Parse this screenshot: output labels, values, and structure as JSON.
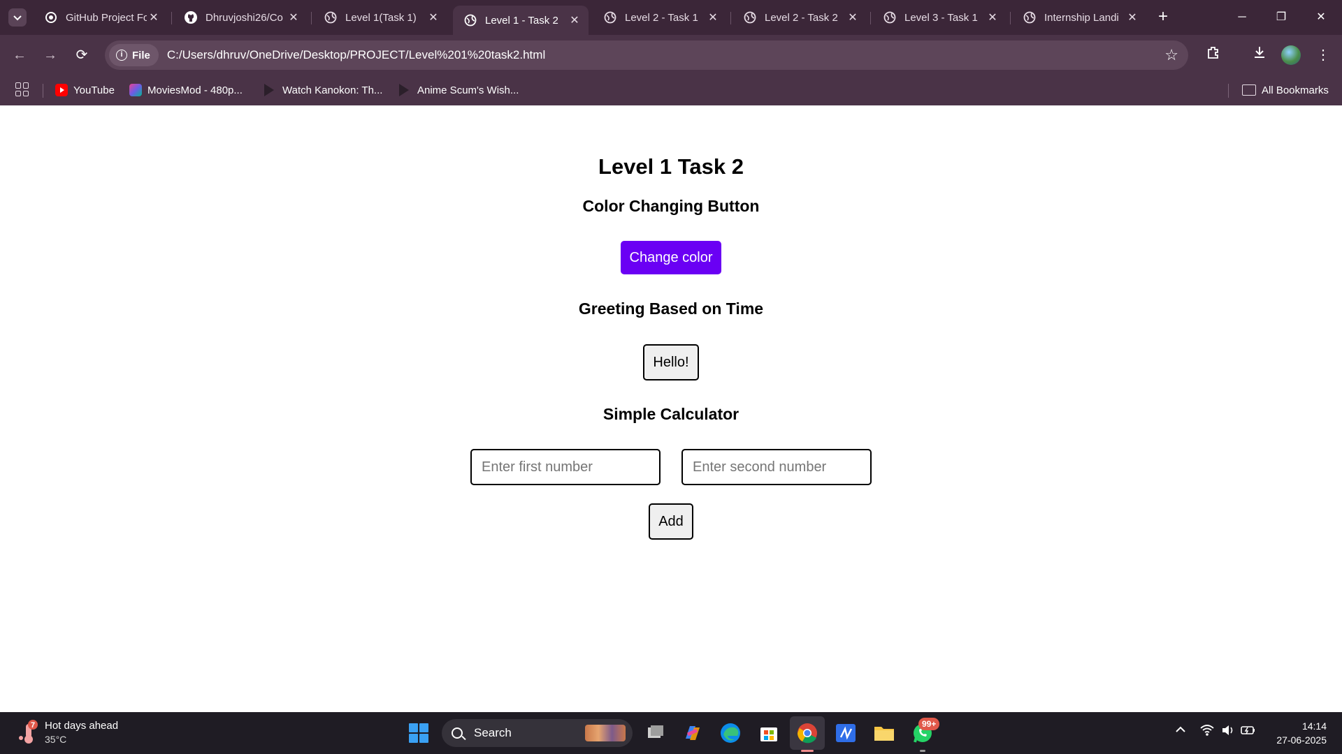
{
  "browser": {
    "tabs": [
      {
        "title": "GitHub Project Fo",
        "active": false
      },
      {
        "title": "Dhruvjoshi26/Co",
        "active": false
      },
      {
        "title": "Level 1(Task 1)",
        "active": false
      },
      {
        "title": "Level 1 - Task 2",
        "active": true
      },
      {
        "title": "Level 2 - Task 1",
        "active": false
      },
      {
        "title": "Level 2 - Task 2",
        "active": false
      },
      {
        "title": "Level 3 - Task 1",
        "active": false
      },
      {
        "title": "Internship Landi",
        "active": false
      }
    ],
    "new_tab_label": "+",
    "address": {
      "scheme_chip": "File",
      "url": "C:/Users/dhruv/OneDrive/Desktop/PROJECT/Level%201%20task2.html"
    },
    "bookmarks": [
      {
        "label": "YouTube",
        "icon": "youtube-icon"
      },
      {
        "label": "MoviesMod - 480p...",
        "icon": "moviesmod-icon"
      },
      {
        "label": "Watch Kanokon: Th...",
        "icon": "play-icon"
      },
      {
        "label": "Anime Scum's Wish...",
        "icon": "play-icon"
      }
    ],
    "all_bookmarks_label": "All Bookmarks"
  },
  "page": {
    "title": "Level 1 Task 2",
    "color_section": {
      "heading": "Color Changing Button",
      "button_label": "Change color",
      "button_color": "#6a00f4"
    },
    "greeting_section": {
      "heading": "Greeting Based on Time",
      "button_label": "Hello!"
    },
    "calculator_section": {
      "heading": "Simple Calculator",
      "first_placeholder": "Enter first number",
      "second_placeholder": "Enter second number",
      "first_value": "",
      "second_value": "",
      "add_label": "Add"
    }
  },
  "taskbar": {
    "weather": {
      "title": "Hot days ahead",
      "temp": "35°C",
      "alert_count": "7"
    },
    "search_label": "Search",
    "apps": [
      "task-view-icon",
      "copilot-icon",
      "edge-icon",
      "store-icon",
      "chrome-icon",
      "visual-studio-icon",
      "file-explorer-icon",
      "whatsapp-icon"
    ],
    "whatsapp_badge": "99+",
    "clock": {
      "time": "14:14",
      "date": "27-06-2025"
    }
  }
}
